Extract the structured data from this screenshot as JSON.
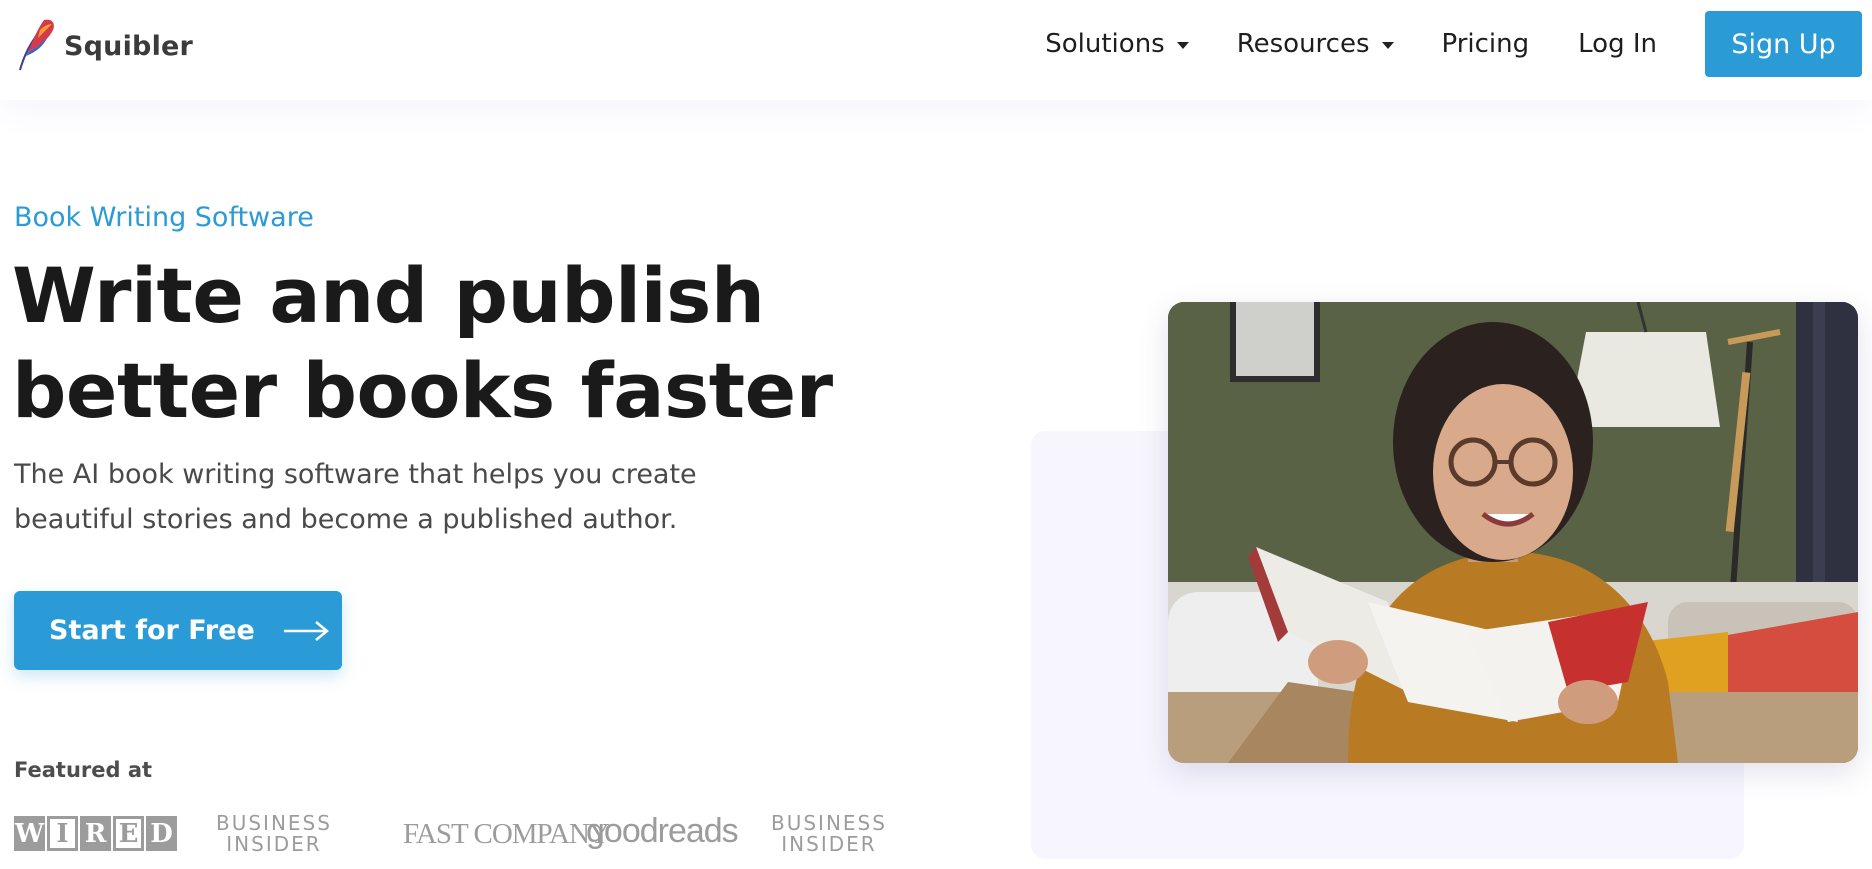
{
  "brand": {
    "name": "Squibler",
    "logo_icon": "quill-feather-icon"
  },
  "nav": {
    "solutions": "Solutions",
    "resources": "Resources",
    "pricing": "Pricing",
    "login": "Log In",
    "signup": "Sign Up"
  },
  "hero": {
    "eyebrow": "Book Writing Software",
    "headline_line1": "Write and publish",
    "headline_line2": "better books faster",
    "sub_line1": "The AI book writing software that helps you create",
    "sub_line2": "beautiful stories and become a published author.",
    "cta": "Start for Free",
    "cta_icon": "arrow-right-icon",
    "image": "woman-reading-book-photo"
  },
  "featured": {
    "label": "Featured at",
    "logos": {
      "wired": [
        "W",
        "I",
        "R",
        "E",
        "D"
      ],
      "business_insider_1": [
        "BUSINESS",
        "INSIDER"
      ],
      "fast_company": "FAST COMPANY",
      "goodreads": "goodreads",
      "business_insider_2": [
        "BUSINESS",
        "INSIDER"
      ]
    }
  },
  "colors": {
    "accent": "#2b9bd8",
    "text": "#1a1a1a",
    "muted": "#9c9c9c"
  }
}
